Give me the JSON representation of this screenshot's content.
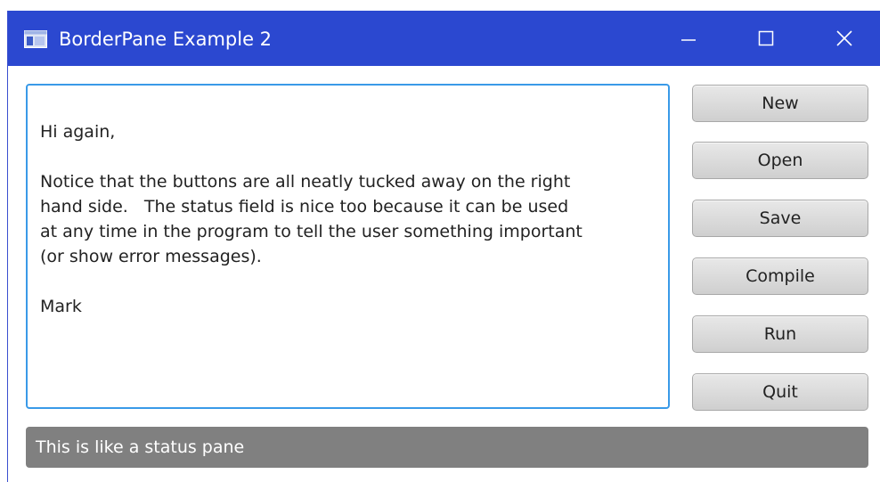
{
  "window": {
    "title": "BorderPane Example 2",
    "title_bar_color": "#2b48d0",
    "icons": {
      "app": "window-app-icon",
      "minimize": "minimize-icon",
      "maximize": "maximize-icon",
      "close": "close-icon"
    }
  },
  "editor": {
    "lines": [
      "",
      "Hi again,",
      "",
      "Notice that the buttons are all neatly tucked away on the right",
      "hand side.   The status field is nice too because it can be used",
      "at any time in the program to tell the user something important",
      "(or show error messages).",
      "",
      "Mark"
    ],
    "focus_color": "#3a9ae8"
  },
  "buttons": {
    "new": "New",
    "open": "Open",
    "save": "Save",
    "compile": "Compile",
    "run": "Run",
    "quit": "Quit"
  },
  "status": {
    "text": "This is like a status pane",
    "color": "#808080"
  }
}
